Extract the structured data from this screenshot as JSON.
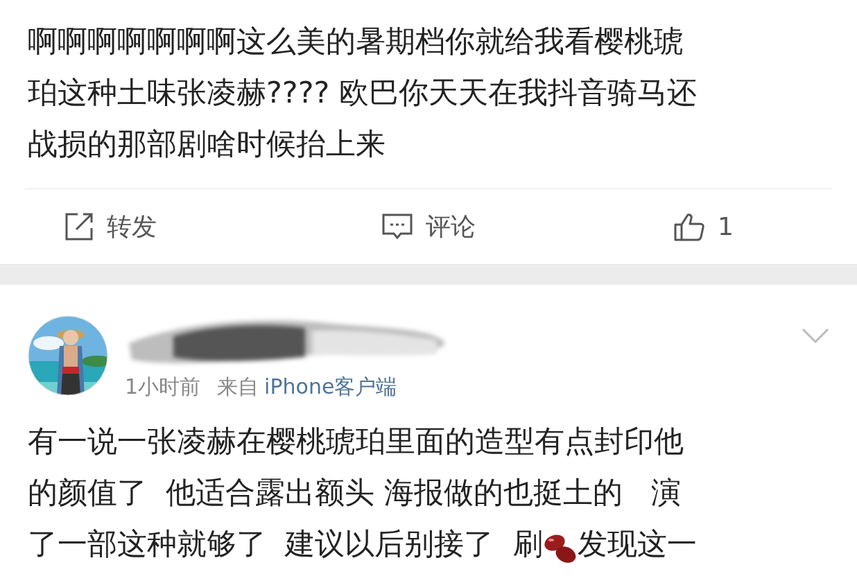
{
  "post": {
    "text_lines": [
      "啊啊啊啊啊啊啊这么美的暑期档你就给我看樱桃琥",
      "珀这种土味张凌赫???? 欧巴你天天在我抖音骑马还",
      "战损的那部剧啥时候抬上来"
    ],
    "actions": [
      {
        "kind": "repost",
        "label": "转发"
      },
      {
        "kind": "comment",
        "label": "评论"
      },
      {
        "kind": "like",
        "label": "1"
      }
    ]
  },
  "comment": {
    "time": "1小时前",
    "source_prefix": "来自",
    "source": "iPhone客户端",
    "text_lines": [
      "有一说一张凌赫在樱桃琥珀里面的造型有点封印他",
      "的颜值了  他适合露出额头 海报做的也挺土的   演",
      "了一部这种就够了  建议以后别接了  刷"
    ],
    "text_after_emoji": "发现这一"
  }
}
